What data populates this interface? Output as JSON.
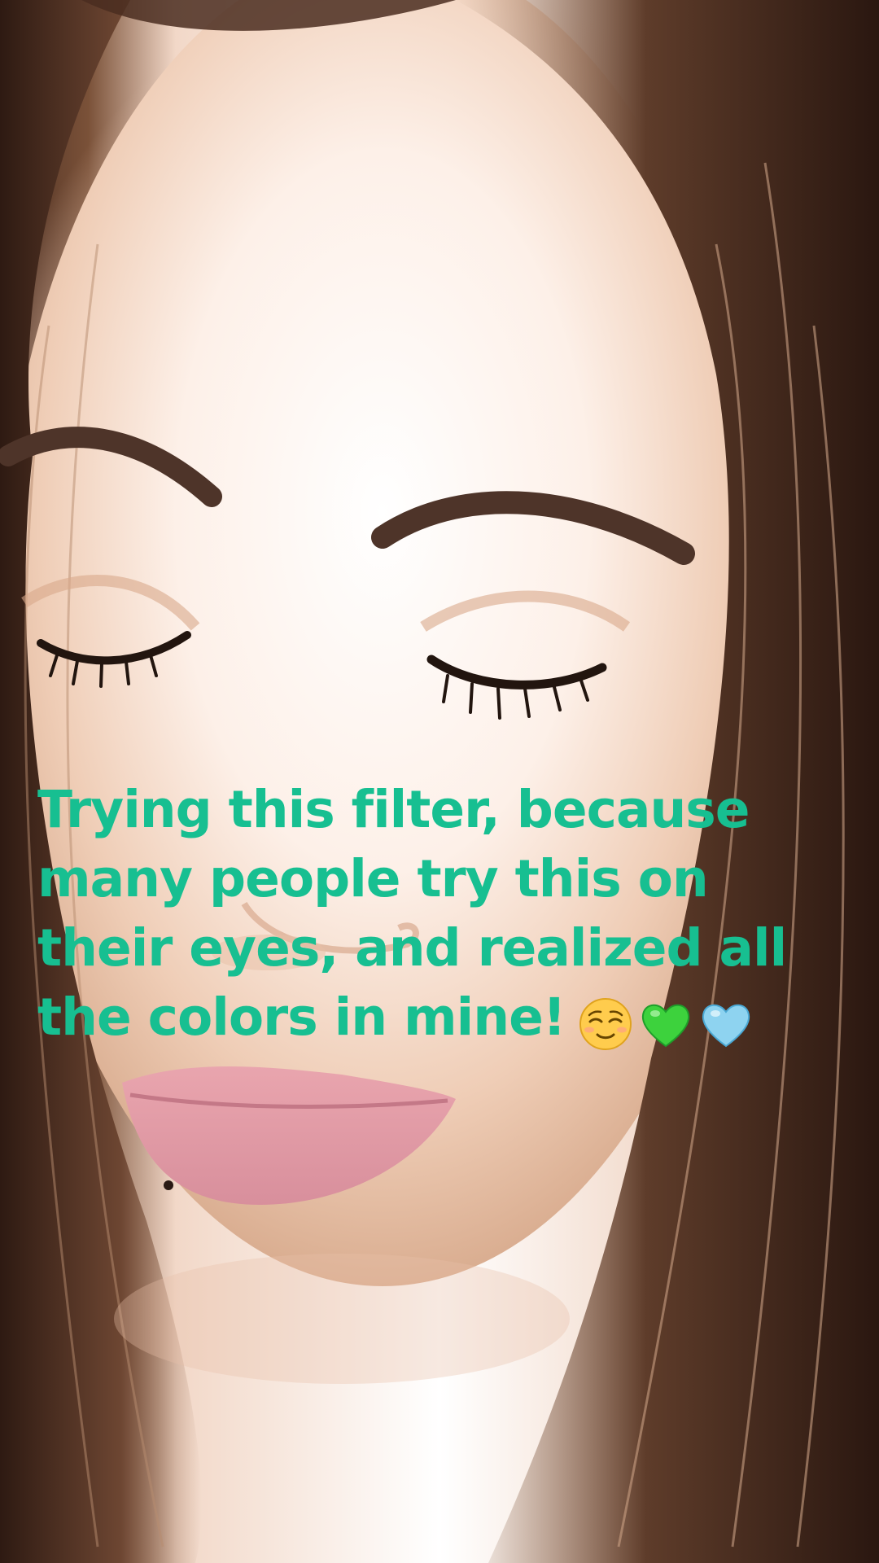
{
  "caption": {
    "lines": [
      "Trying this filter, because",
      "many people try this on",
      "their eyes, and realized all",
      "the colors in mine!"
    ],
    "color": "#17bf91"
  },
  "emojis": [
    {
      "name": "relieved-face-icon"
    },
    {
      "name": "green-heart-icon",
      "color": "#3dd23d"
    },
    {
      "name": "light-blue-heart-icon",
      "color": "#8ed3f0"
    }
  ]
}
